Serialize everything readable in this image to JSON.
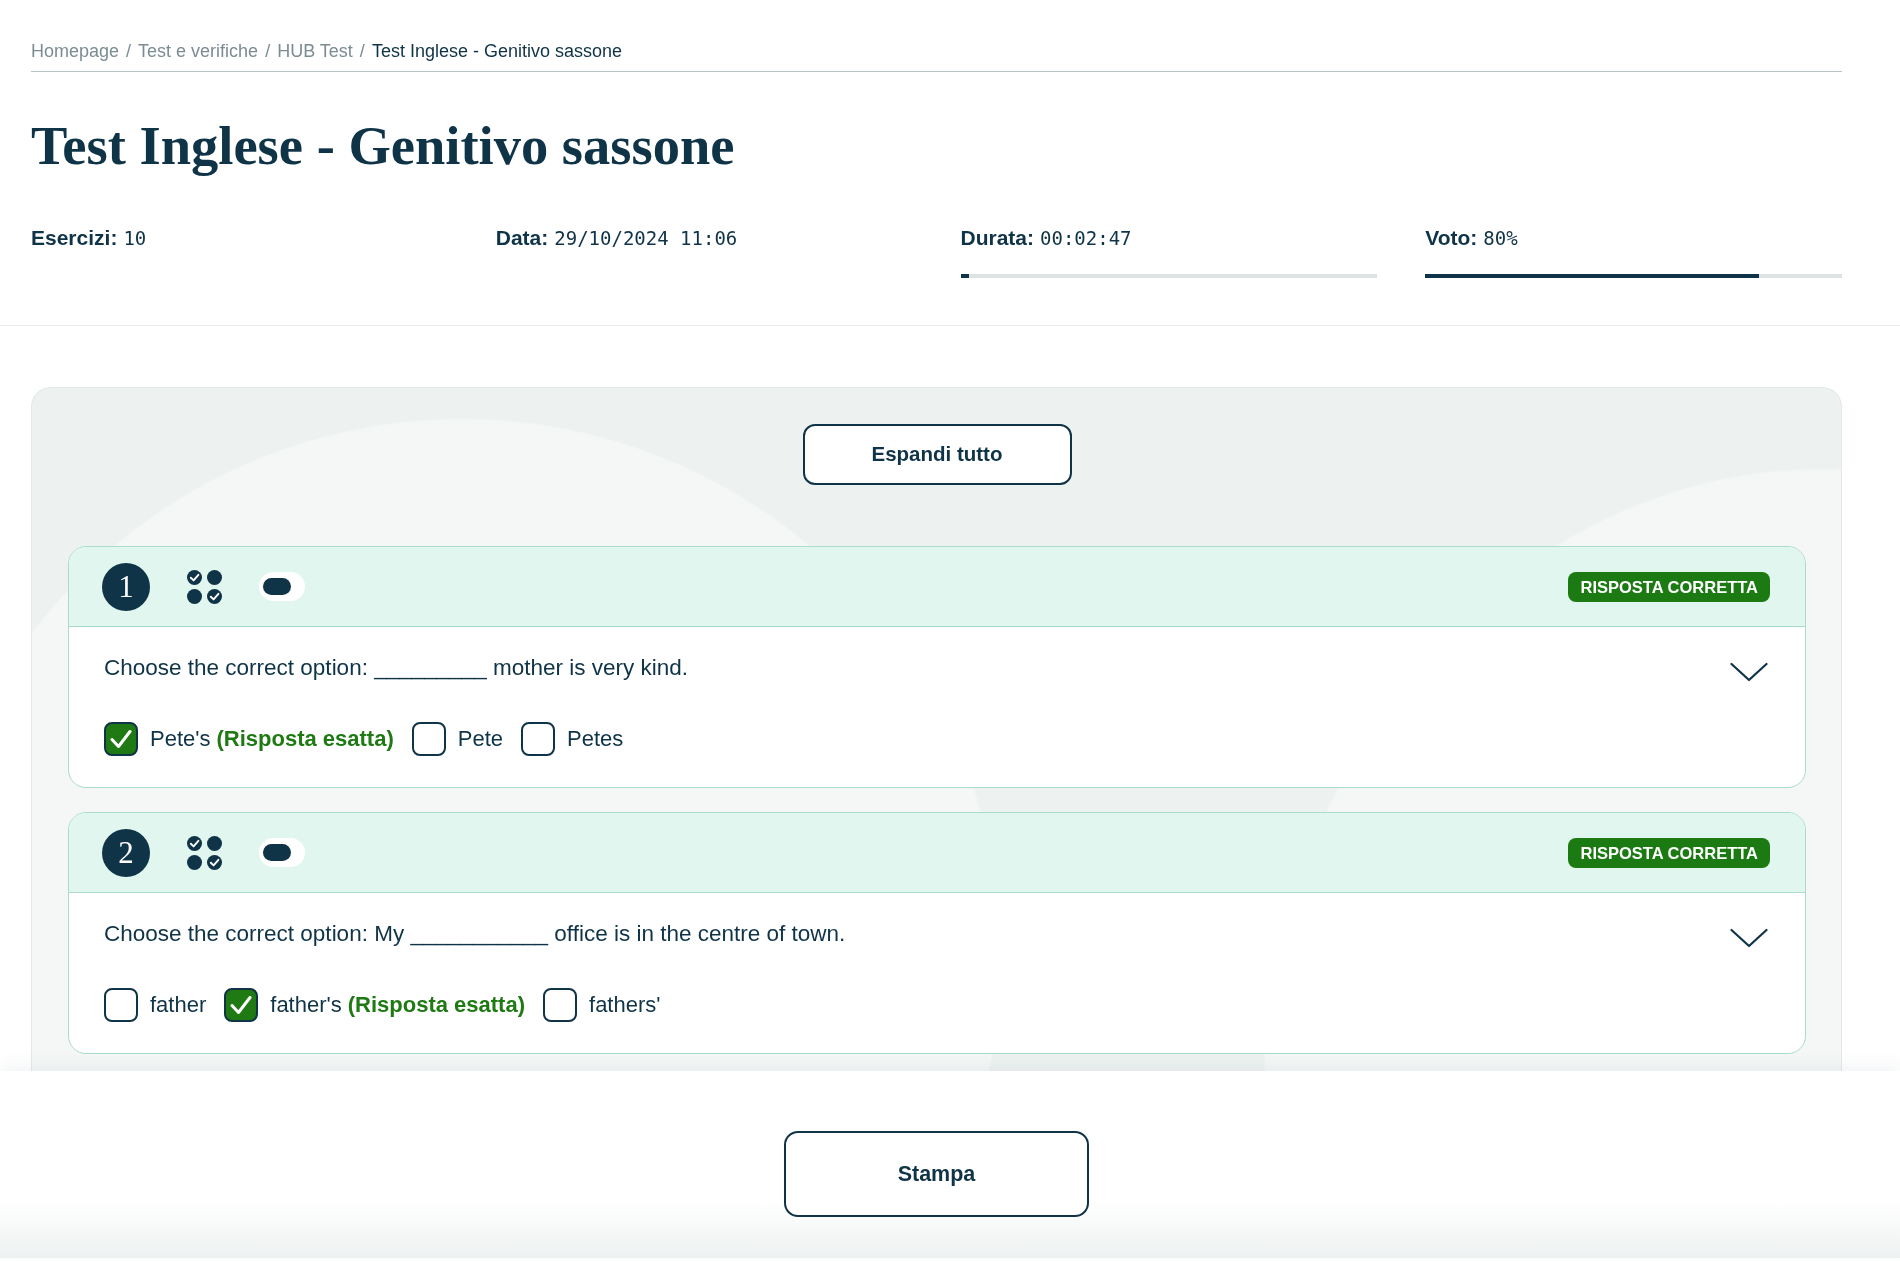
{
  "breadcrumb": [
    {
      "label": "Homepage",
      "current": false
    },
    {
      "separator": "/",
      "label": "Test e verifiche",
      "current": false
    },
    {
      "separator": "/",
      "label": "HUB Test",
      "current": false
    },
    {
      "separator": "/",
      "label": "Test Inglese - Genitivo sassone",
      "current": true
    }
  ],
  "title": "Test Inglese - Genitivo sassone",
  "stats": [
    {
      "label": "Esercizi:",
      "value": "10"
    },
    {
      "label": "Data:",
      "value": "29/10/2024 11:06"
    },
    {
      "label": "Durata:",
      "value": "00:02:47",
      "level": 0.02
    },
    {
      "label": "Voto:",
      "value": "80%",
      "level": 0.8
    }
  ],
  "expand_button": "Espandi tutto",
  "exercises": [
    {
      "number": "1",
      "status": "RISPOSTA CORRETTA",
      "question": "Choose the correct option: _________ mother is very kind.",
      "options": [
        {
          "label": "Pete's",
          "note": "(Risposta esatta)",
          "checked": true
        },
        {
          "label": "Pete",
          "checked": false
        },
        {
          "label": "Petes",
          "checked": false
        }
      ]
    },
    {
      "number": "2",
      "status": "RISPOSTA CORRETTA",
      "question": "Choose the correct option: My ___________ office is in the centre of town.",
      "options": [
        {
          "label": "father",
          "checked": false
        },
        {
          "label": "father's",
          "note": "(Risposta esatta)",
          "checked": true
        },
        {
          "label": "fathers'",
          "checked": false
        }
      ]
    }
  ],
  "print_button": "Stampa"
}
